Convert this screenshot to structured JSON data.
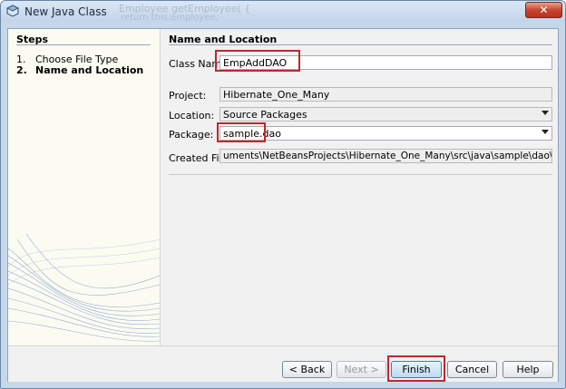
{
  "window": {
    "title": "New Java Class",
    "close_glyph": "✕"
  },
  "background_ghost": {
    "line1": "Employee getEmployee( {",
    "line2": "return this.employee;"
  },
  "steps": {
    "title": "Steps",
    "items": [
      {
        "num": "1.",
        "label": "Choose File Type"
      },
      {
        "num": "2.",
        "label": "Name and Location"
      }
    ]
  },
  "panel": {
    "title": "Name and Location",
    "class_name": {
      "label": "Class Name:",
      "value": "EmpAddDAO"
    },
    "project": {
      "label": "Project:",
      "value": "Hibernate_One_Many"
    },
    "location": {
      "label": "Location:",
      "value": "Source Packages"
    },
    "package": {
      "label": "Package:",
      "value": "sample.dao"
    },
    "created_file": {
      "label": "Created File:",
      "value": "uments\\NetBeansProjects\\Hibernate_One_Many\\src\\java\\sample\\dao\\EmpAddDAO.java"
    }
  },
  "buttons": {
    "back": "< Back",
    "next": "Next >",
    "finish": "Finish",
    "cancel": "Cancel",
    "help": "Help"
  },
  "colors": {
    "highlight": "#c1272d",
    "title_bar": "#c7d7ea"
  },
  "icons": [
    "netbeans-icon",
    "close-icon",
    "dropdown-arrow-icon"
  ]
}
